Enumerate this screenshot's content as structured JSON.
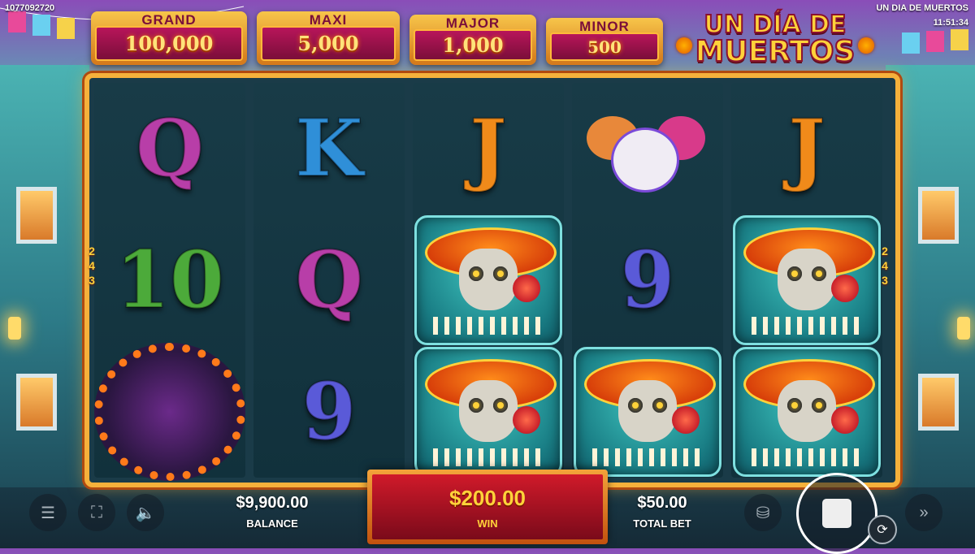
{
  "header": {
    "round_id": "1077092720",
    "game_name": "UN DIA DE MUERTOS",
    "clock": "11:51:34"
  },
  "jackpots": [
    {
      "label": "GRAND",
      "value": "100,000"
    },
    {
      "label": "MAXI",
      "value": "5,000"
    },
    {
      "label": "MAJOR",
      "value": "1,000"
    },
    {
      "label": "MINOR",
      "value": "500"
    }
  ],
  "logo": {
    "line1": "UN DÍA DE",
    "line2": "MUERTOS"
  },
  "ways": {
    "left": [
      "2",
      "4",
      "3"
    ],
    "right": [
      "2",
      "4",
      "3"
    ]
  },
  "reels": [
    [
      {
        "type": "letter",
        "text": "Q",
        "color": "#b83ea8"
      },
      {
        "type": "letter",
        "text": "10",
        "color": "#4caa3a"
      },
      {
        "type": "altar"
      }
    ],
    [
      {
        "type": "letter",
        "text": "K",
        "color": "#2f8fd8"
      },
      {
        "type": "letter",
        "text": "Q",
        "color": "#b83ea8"
      },
      {
        "type": "letter",
        "text": "9",
        "color": "#5a5ad8"
      }
    ],
    [
      {
        "type": "letter",
        "text": "J",
        "color": "#f08a1a"
      },
      {
        "type": "skull"
      },
      {
        "type": "skull"
      }
    ],
    [
      {
        "type": "cookies"
      },
      {
        "type": "letter",
        "text": "9",
        "color": "#5a5ad8"
      },
      {
        "type": "skull"
      }
    ],
    [
      {
        "type": "letter",
        "text": "J",
        "color": "#f08a1a"
      },
      {
        "type": "skull"
      },
      {
        "type": "skull"
      }
    ]
  ],
  "bottom": {
    "balance_value": "$9,900.00",
    "balance_label": "BALANCE",
    "win_value": "$200.00",
    "win_label": "WIN",
    "bet_value": "$50.00",
    "bet_label": "TOTAL BET"
  },
  "icons": {
    "menu": "menu-icon",
    "fullscreen": "fullscreen-icon",
    "sound": "speaker-icon",
    "coins": "coins-icon",
    "spin": "stop-icon",
    "autoplay": "autoplay-icon",
    "turbo": "fast-forward-icon"
  },
  "colors": {
    "accent": "#ffd23a",
    "win_bg": "#d01a2a",
    "frame": "#f6b13b"
  }
}
